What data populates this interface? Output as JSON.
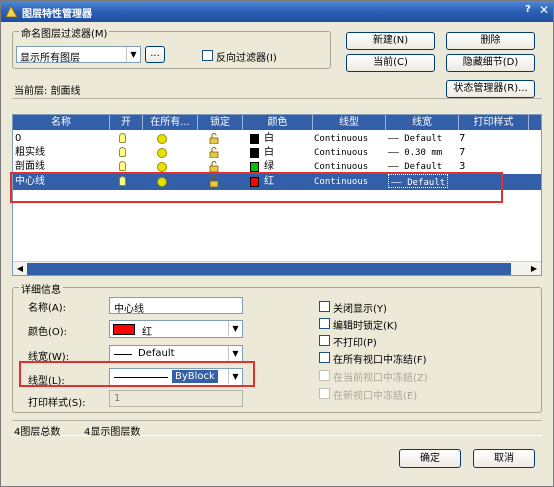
{
  "window": {
    "title": "图层特性管理器",
    "help": "?",
    "close": "✕"
  },
  "filter": {
    "group_label": "命名图层过滤器(M)",
    "selected": "显示所有图层",
    "more_button": "...",
    "invert_label": "反向过滤器(I)"
  },
  "buttons": {
    "new": "新建(N)",
    "delete": "删除",
    "current": "当前(C)",
    "hide_details": "隐藏细节(D)",
    "state_manager": "状态管理器(R)...",
    "ok": "确定",
    "cancel": "取消"
  },
  "current_layer": "当前层: 剖面线",
  "columns": [
    "名称",
    "开",
    "在所有...",
    "锁定",
    "颜色",
    "线型",
    "线宽",
    "打印样式"
  ],
  "layers": [
    {
      "name": "0",
      "color_name": "白",
      "color": "#000000",
      "linetype": "Continuous",
      "lineweight": "—— Default",
      "plot": "7",
      "selected": false
    },
    {
      "name": "粗实线",
      "color_name": "白",
      "color": "#000000",
      "linetype": "Continuous",
      "lineweight": "—— 0.30 mm",
      "plot": "7",
      "selected": false
    },
    {
      "name": "剖面线",
      "color_name": "绿",
      "color": "#00c000",
      "linetype": "Continuous",
      "lineweight": "—— Default",
      "plot": "3",
      "selected": false
    },
    {
      "name": "中心线",
      "color_name": "红",
      "color": "#ff0000",
      "linetype": "Continuous",
      "lineweight": "—— Default",
      "plot": "",
      "selected": true
    }
  ],
  "details": {
    "group_label": "详细信息",
    "name_label": "名称(A):",
    "name_value": "中心线",
    "color_label": "颜色(O):",
    "color_value": "红",
    "color_hex": "#ff0000",
    "lineweight_label": "线宽(W):",
    "lineweight_value": "Default",
    "linetype_label": "线型(L):",
    "linetype_value": "ByBlock",
    "plotstyle_label": "打印样式(S):",
    "plotstyle_value": "1",
    "options": [
      {
        "label": "关闭显示(Y)",
        "enabled": true
      },
      {
        "label": "编辑时锁定(K)",
        "enabled": true
      },
      {
        "label": "不打印(P)",
        "enabled": true
      },
      {
        "label": "在所有视口中冻结(F)",
        "enabled": true
      },
      {
        "label": "在当前视口中冻结(Z)",
        "enabled": false
      },
      {
        "label": "在新视口中冻结(E)",
        "enabled": false
      }
    ]
  },
  "status": {
    "total": "4图层总数",
    "shown": "4显示图层数"
  },
  "colors": {
    "title_blue": "#2b5fb5",
    "highlight": "#335ea8",
    "annotation_red": "#e03030"
  }
}
